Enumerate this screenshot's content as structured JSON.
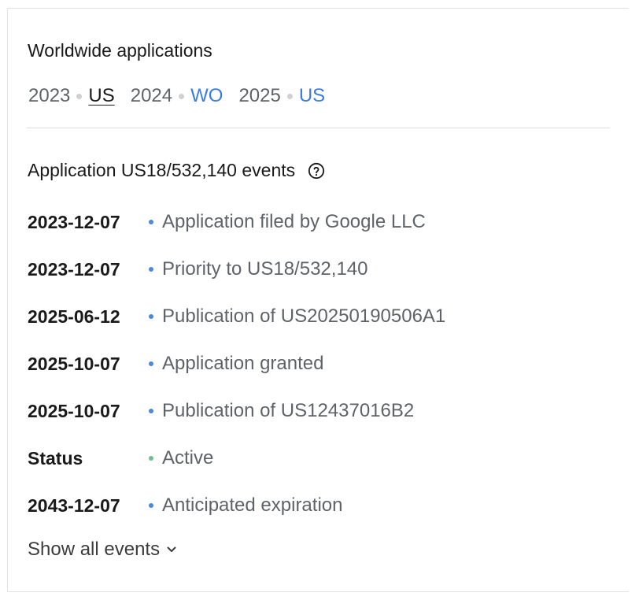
{
  "worldwide": {
    "title": "Worldwide applications",
    "groups": [
      {
        "year": "2023",
        "code": "US",
        "current": true
      },
      {
        "year": "2024",
        "code": "WO",
        "current": false
      },
      {
        "year": "2025",
        "code": "US",
        "current": false
      }
    ]
  },
  "events": {
    "title": "Application US18/532,140 events",
    "help_icon": "help-circle-icon",
    "dot_color": "#4a86e8",
    "status_color": "#6fbf8e",
    "items": [
      {
        "date": "2023-12-07",
        "description": "Application filed by Google LLC"
      },
      {
        "date": "2023-12-07",
        "description": "Priority to US18/532,140"
      },
      {
        "date": "2025-06-12",
        "description": "Publication of US20250190506A1"
      },
      {
        "date": "2025-10-07",
        "description": "Application granted"
      },
      {
        "date": "2025-10-07",
        "description": "Publication of US12437016B2"
      },
      {
        "date": "Status",
        "description": "Active"
      },
      {
        "date": "2043-12-07",
        "description": "Anticipated expiration"
      }
    ],
    "show_all_label": "Show all events"
  }
}
